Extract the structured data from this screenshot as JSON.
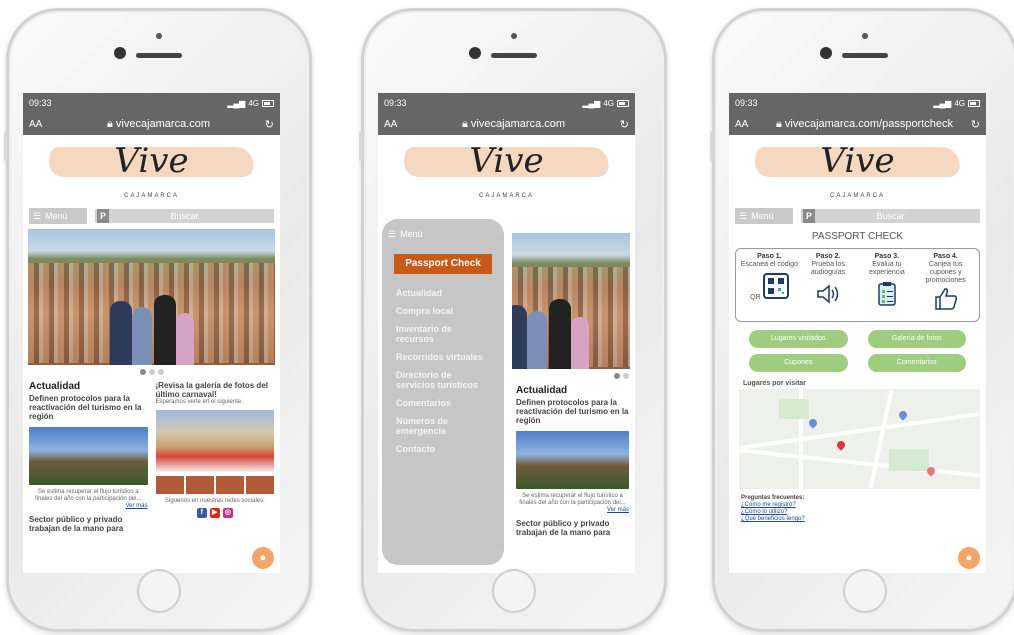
{
  "colors": {
    "accent": "#c85a19",
    "green": "#9fcd7f",
    "menu_bg": "#c6c6c6",
    "bar": "#666666"
  },
  "status": {
    "time": "09:33",
    "network": "4G"
  },
  "browser": {
    "font_size_label": "AA",
    "url_home": "vivecajamarca.com",
    "url_passport": "vivecajamarca.com/passportcheck"
  },
  "logo": {
    "word": "Vive",
    "sub": "CAJAMARCA"
  },
  "nav": {
    "menu_label": "Menú",
    "search_label": "Buscar"
  },
  "news": {
    "section": "Actualidad",
    "headline": "Definen protocolos para la reactivación del turismo en la región",
    "excerpt": "Se estima recuperar el flujo turístico a finales del año con la participación del...",
    "more": "Ver más",
    "headline2": "Sector público y privado trabajan de la mano para"
  },
  "gallery": {
    "title": "¡Revisa la galería de fotos del último carnaval!",
    "sub": "Esperamos verte en el siguiente.",
    "social_label": "Síguenos en nuestras redes sociales:"
  },
  "sidemenu": {
    "title": "Menú",
    "passport": "Passport Check",
    "items": [
      "Actualidad",
      "Compra local",
      "Inventario de recursos",
      "Recorridos virtuales",
      "Directorio de servicios turísticos",
      "Comentarios",
      "Números de emergencia",
      "Contacto"
    ]
  },
  "passport": {
    "title": "PASSPORT CHECK",
    "steps": [
      {
        "n": "Paso 1.",
        "t": "Escanea el código QR",
        "icon": "qr-code-icon"
      },
      {
        "n": "Paso 2.",
        "t": "Prueba los audioguías",
        "icon": "speaker-icon"
      },
      {
        "n": "Paso 3.",
        "t": "Evalúa tu experiencia",
        "icon": "clipboard-icon"
      },
      {
        "n": "Paso 4.",
        "t": "Canjea tus cupones y promociones",
        "icon": "thumbs-up-icon"
      }
    ],
    "buttons": [
      "Lugares visitados",
      "Galería de fotos",
      "Cupones",
      "Comentarios"
    ],
    "places_label": "Lugares por visitar",
    "faq_title": "Preguntas frecuentes:",
    "faq": [
      "¿Cómo me registro?",
      "¿Cómo lo utilizo?",
      "¿Qué beneficios tengo?"
    ]
  }
}
